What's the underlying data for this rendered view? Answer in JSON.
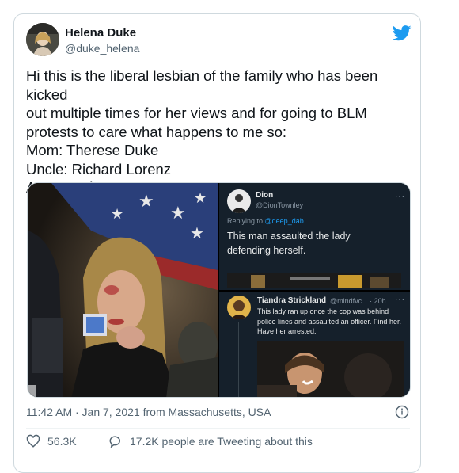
{
  "author": {
    "name": "Helena Duke",
    "handle": "@duke_helena",
    "avatar_icon": "profile-photo"
  },
  "tweet": {
    "text": "Hi this is the liberal lesbian of the family who has been kicked\nout multiple times for her views and for going to BLM\nprotests to care what happens to me so:\nMom: Therese Duke\nUncle: Richard Lorenz\nAunt: Annie Lorenz",
    "timestamp": "11:42 AM · Jan 7, 2021 from Massachusetts, USA"
  },
  "media": {
    "left_photo": {
      "description_icon": "protest-photo"
    },
    "embedded_tweet_1": {
      "name": "Dion",
      "handle": "@DionTownley",
      "replying_prefix": "Replying to ",
      "replying_to": "@deep_dab",
      "text": "This man assaulted the lady defending herself.",
      "dots": "···"
    },
    "embedded_tweet_2": {
      "name": "Tiandra Strickland",
      "handle": "@mindfvc... · 20h",
      "text": "This lady ran up once the cop was behind police lines and assaulted an officer. Find her. Have her arrested.",
      "dots": "···"
    }
  },
  "actions": {
    "likes": "56.3K",
    "tweeting_about": "17.2K people are Tweeting about this"
  },
  "colors": {
    "brand": "#1d9bf0",
    "text_secondary": "#536471",
    "border": "#cfd9de"
  }
}
